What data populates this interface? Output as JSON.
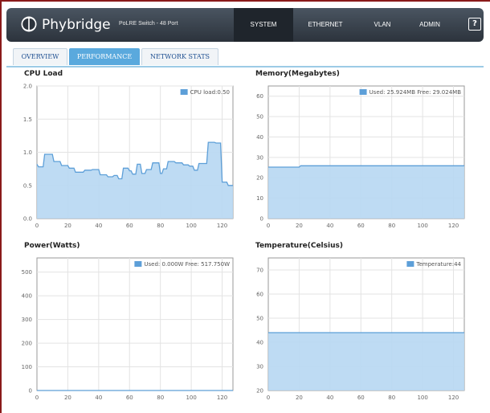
{
  "header": {
    "brand": "Phybridge",
    "subtitle": "PoLRE Switch - 48 Port",
    "nav": [
      "SYSTEM",
      "ETHERNET",
      "VLAN",
      "ADMIN"
    ],
    "active_nav": "SYSTEM",
    "help_label": "?",
    "logo_icon": "phybridge-logo-icon"
  },
  "tabs": {
    "items": [
      "OVERVIEW",
      "PERFORMANCE",
      "NETWORK STATS"
    ],
    "active": "PERFORMANCE"
  },
  "colors": {
    "fill": "#b7d7f2",
    "line": "#5d9fd8",
    "grid": "#e3e3e3",
    "axis": "#999999",
    "tab_active": "#5aa9dd"
  },
  "chart_data": [
    {
      "type": "area",
      "title": "CPU Load",
      "legend": "CPU load:0.50",
      "legend_position": "top-right",
      "grid": true,
      "xlim": [
        0,
        127
      ],
      "ylim": [
        0,
        2.0
      ],
      "xticks": [
        0,
        20,
        40,
        60,
        80,
        100,
        120
      ],
      "yticks": [
        0.0,
        0.5,
        1.0,
        1.5,
        2.0
      ],
      "ytick_labels": [
        "0.0",
        "0.5",
        "1.0",
        "1.5",
        "2.0"
      ],
      "x": [
        0,
        1,
        4,
        5,
        10,
        11,
        15,
        16,
        20,
        21,
        24,
        25,
        30,
        31,
        35,
        36,
        40,
        41,
        45,
        46,
        49,
        50,
        52,
        53,
        55,
        56,
        59,
        60,
        61,
        62,
        64,
        65,
        67,
        68,
        70,
        71,
        74,
        75,
        79,
        80,
        81,
        82,
        84,
        85,
        89,
        90,
        94,
        95,
        98,
        99,
        101,
        102,
        104,
        105,
        110,
        111,
        115,
        116,
        119,
        120,
        123,
        124,
        127
      ],
      "y": [
        0.82,
        0.78,
        0.78,
        0.97,
        0.97,
        0.86,
        0.86,
        0.8,
        0.8,
        0.76,
        0.76,
        0.7,
        0.7,
        0.73,
        0.73,
        0.74,
        0.74,
        0.66,
        0.66,
        0.63,
        0.63,
        0.65,
        0.65,
        0.6,
        0.6,
        0.76,
        0.76,
        0.72,
        0.72,
        0.67,
        0.67,
        0.82,
        0.82,
        0.68,
        0.68,
        0.74,
        0.74,
        0.84,
        0.84,
        0.68,
        0.68,
        0.75,
        0.75,
        0.86,
        0.86,
        0.84,
        0.84,
        0.81,
        0.81,
        0.79,
        0.79,
        0.73,
        0.73,
        0.83,
        0.83,
        1.15,
        1.15,
        1.14,
        1.14,
        0.55,
        0.55,
        0.5,
        0.5
      ]
    },
    {
      "type": "area",
      "title": "Memory(Megabytes)",
      "legend": "Used: 25.924MB Free: 29.024MB",
      "legend_position": "top-right",
      "grid": true,
      "xlim": [
        0,
        127
      ],
      "ylim": [
        0,
        65
      ],
      "xticks": [
        0,
        20,
        40,
        60,
        80,
        100,
        120
      ],
      "yticks": [
        0,
        10,
        20,
        30,
        40,
        50,
        60
      ],
      "ytick_labels": [
        "0",
        "10",
        "20",
        "30",
        "40",
        "50",
        "60"
      ],
      "x": [
        0,
        20,
        21,
        127
      ],
      "y": [
        25.2,
        25.2,
        25.9,
        25.9
      ]
    },
    {
      "type": "area",
      "title": "Power(Watts)",
      "legend": "Used: 0.000W Free: 517.750W",
      "legend_position": "top-right",
      "grid": true,
      "xlim": [
        0,
        127
      ],
      "ylim": [
        0,
        560
      ],
      "xticks": [
        0,
        20,
        40,
        60,
        80,
        100,
        120
      ],
      "yticks": [
        0,
        100,
        200,
        300,
        400,
        500
      ],
      "ytick_labels": [
        "0",
        "100",
        "200",
        "300",
        "400",
        "500"
      ],
      "x": [
        0,
        127
      ],
      "y": [
        0,
        0
      ]
    },
    {
      "type": "area",
      "title": "Temperature(Celsius)",
      "legend": "Temperature:44",
      "legend_position": "top-right",
      "grid": true,
      "xlim": [
        0,
        127
      ],
      "ylim": [
        20,
        75
      ],
      "xticks": [
        0,
        20,
        40,
        60,
        80,
        100,
        120
      ],
      "yticks": [
        20,
        30,
        40,
        50,
        60,
        70
      ],
      "ytick_labels": [
        "20",
        "30",
        "40",
        "50",
        "60",
        "70"
      ],
      "x": [
        0,
        127
      ],
      "y": [
        44,
        44
      ]
    }
  ]
}
